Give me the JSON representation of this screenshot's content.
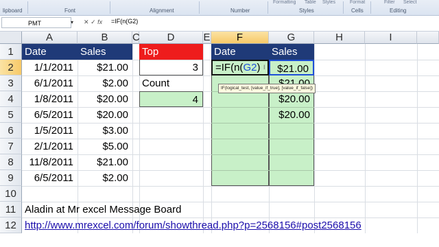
{
  "ribbon": {
    "groups": [
      "lipboard",
      "Font",
      "Alignment",
      "Number",
      "Styles",
      "Cells",
      "Editing"
    ],
    "top_items": [
      "Formatting",
      "Table",
      "Styles",
      "Format",
      "Filter",
      "Select"
    ]
  },
  "formula_bar": {
    "name_box": "PMT",
    "formula": "=IF(n(G2)"
  },
  "columns": [
    "A",
    "B",
    "C",
    "D",
    "E",
    "F",
    "G",
    "H",
    "I"
  ],
  "rows": [
    "1",
    "2",
    "3",
    "4",
    "5",
    "6",
    "7",
    "8",
    "9",
    "10",
    "11",
    "12"
  ],
  "table_headers": {
    "date": "Date",
    "sales": "Sales"
  },
  "data": [
    {
      "date": "1/1/2011",
      "sales": "$21.00"
    },
    {
      "date": "6/1/2011",
      "sales": "$2.00"
    },
    {
      "date": "1/8/2011",
      "sales": "$20.00"
    },
    {
      "date": "6/5/2011",
      "sales": "$20.00"
    },
    {
      "date": "1/5/2011",
      "sales": "$3.00"
    },
    {
      "date": "2/1/2011",
      "sales": "$5.00"
    },
    {
      "date": "11/8/2011",
      "sales": "$21.00"
    },
    {
      "date": "6/5/2011",
      "sales": "$2.00"
    }
  ],
  "top_label": "Top",
  "top_value": "3",
  "count_label": "Count",
  "count_value": "4",
  "result_headers": {
    "date": "Date",
    "sales": "Sales"
  },
  "editing_cell": "=IF(n(G2)",
  "result_sales": [
    "$21.00",
    "$21.00",
    "$20.00",
    "$20.00"
  ],
  "tooltip": "IF(logical_test, [value_if_true], [value_if_false])",
  "note": "Aladin at Mr excel Message Board",
  "url": "http://www.mrexcel.com/forum/showthread.php?p=2568156#post2568156"
}
